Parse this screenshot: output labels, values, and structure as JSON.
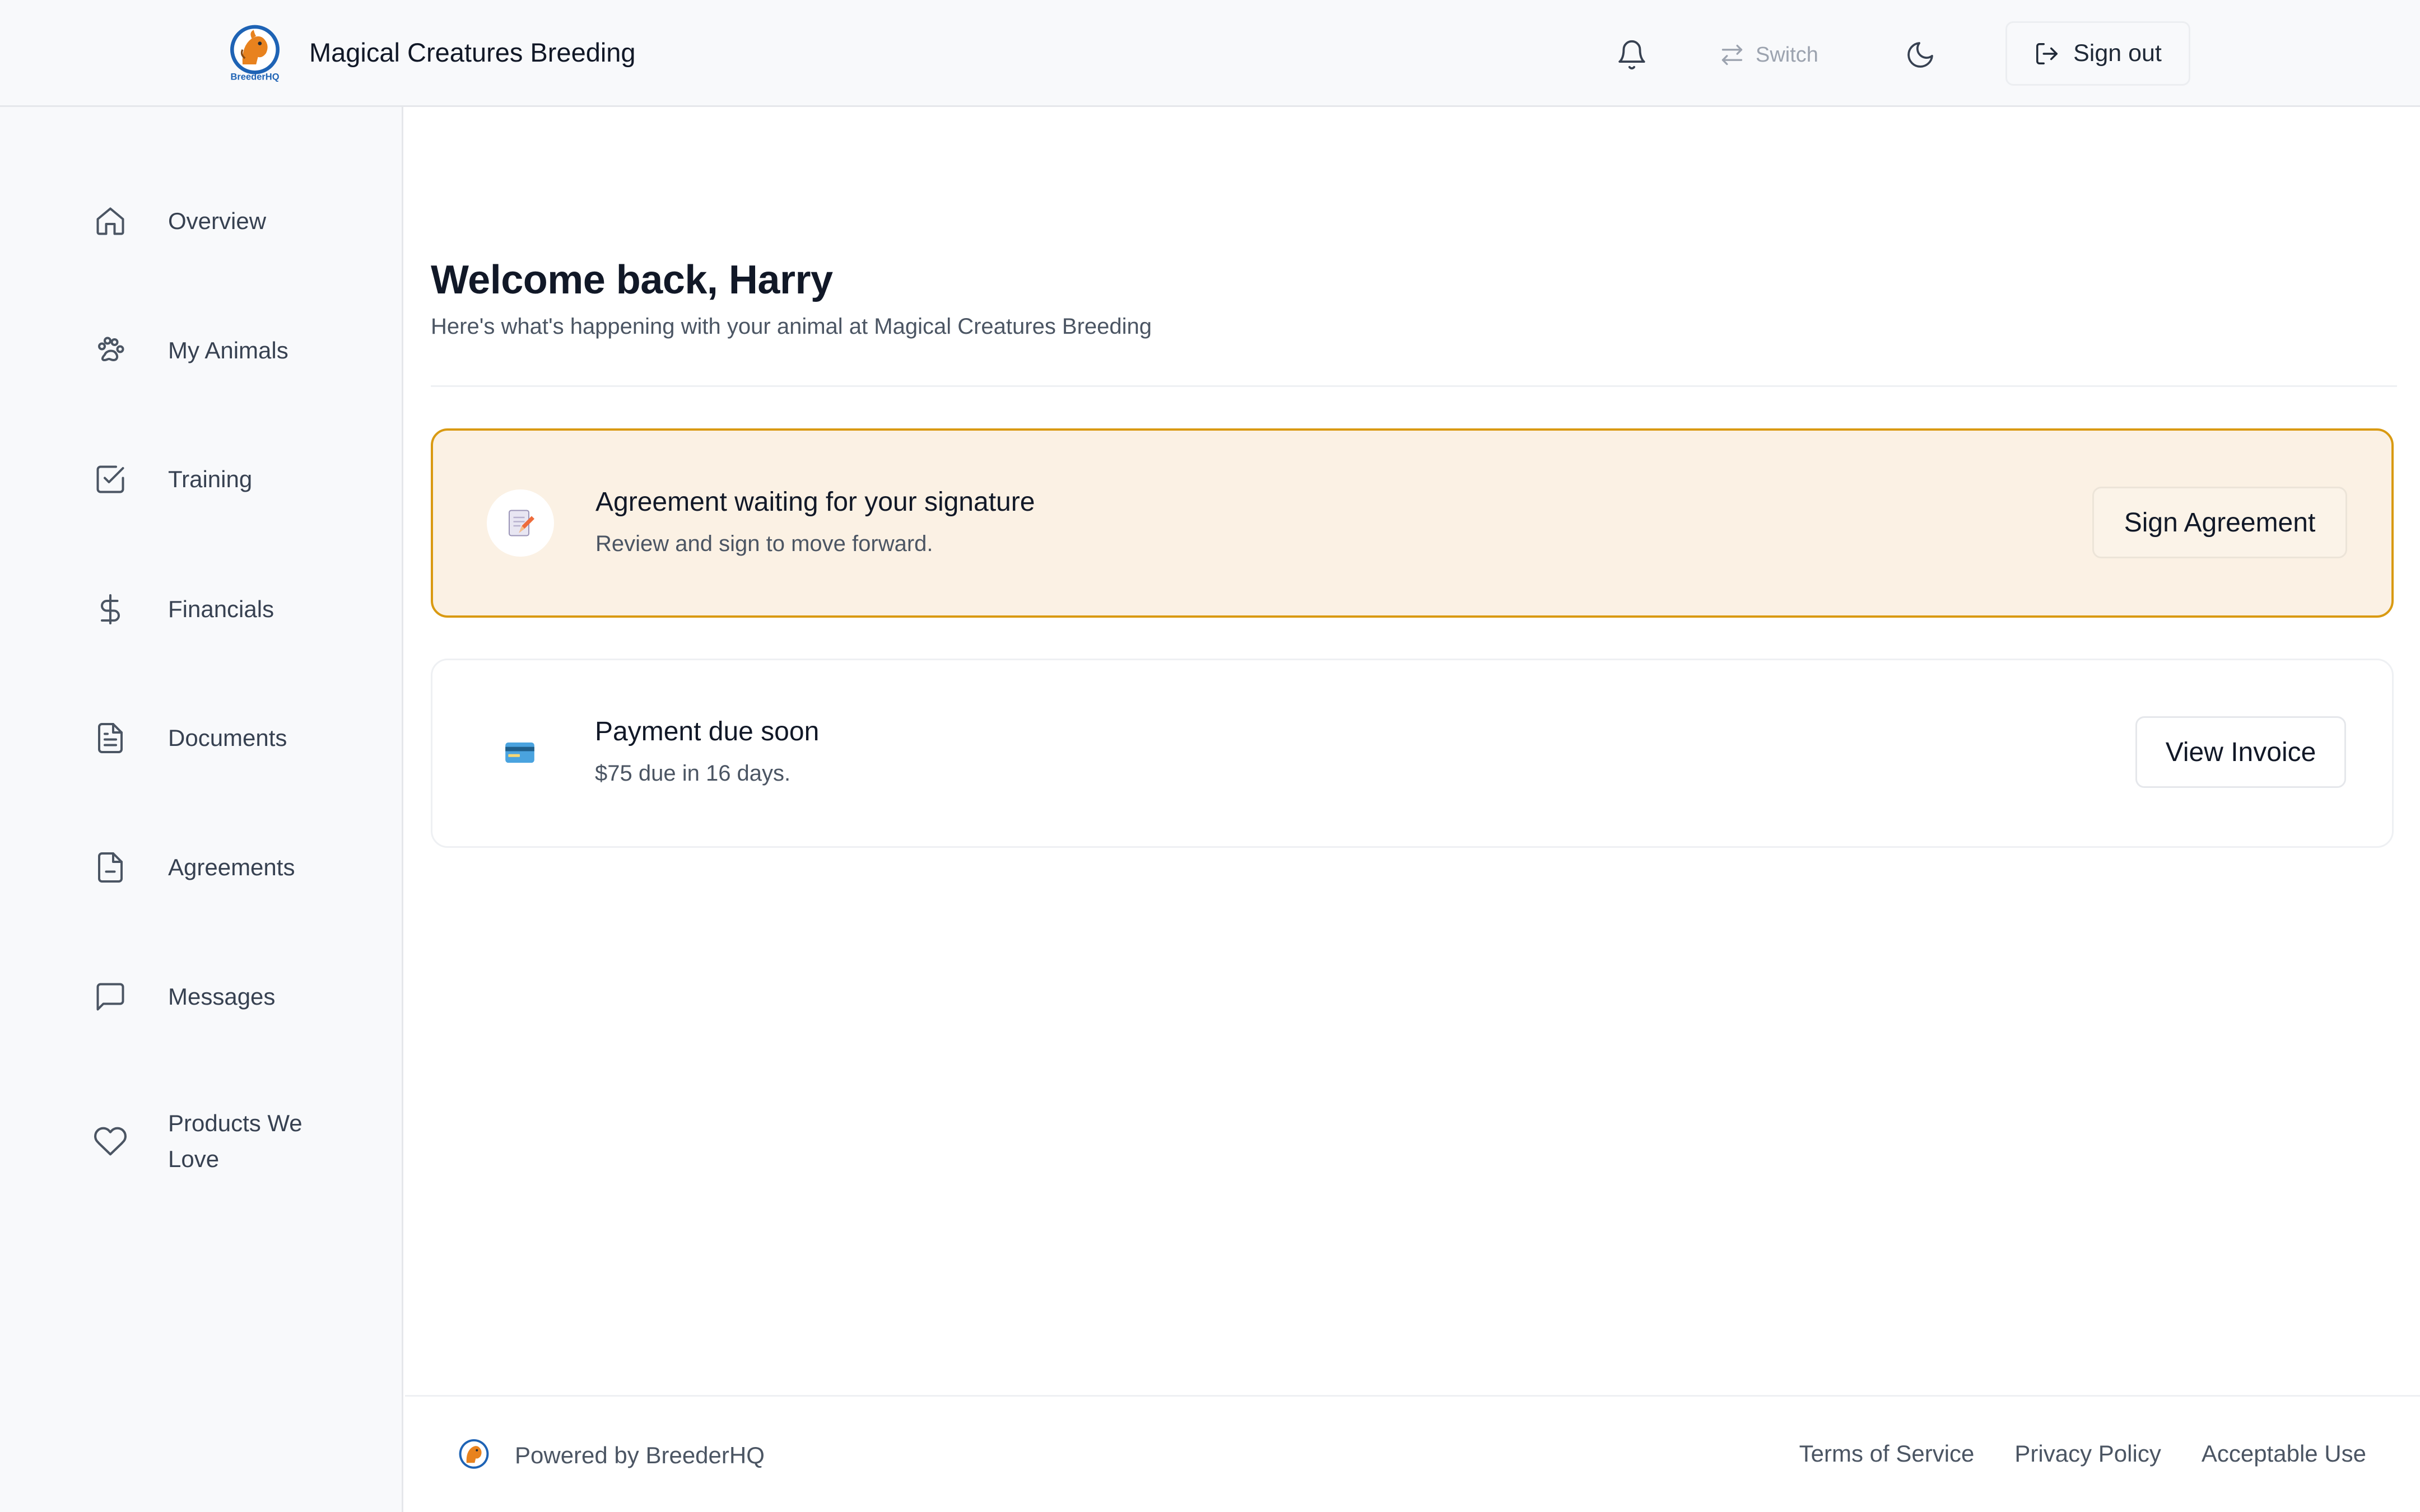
{
  "header": {
    "brand_name": "Magical Creatures Breeding",
    "logo_text": "BreederHQ",
    "switch_label": "Switch",
    "signout_label": "Sign out"
  },
  "sidebar": {
    "items": [
      {
        "label": "Overview",
        "icon": "home-icon"
      },
      {
        "label": "My Animals",
        "icon": "paw-icon"
      },
      {
        "label": "Training",
        "icon": "checkbox-icon"
      },
      {
        "label": "Financials",
        "icon": "dollar-icon"
      },
      {
        "label": "Documents",
        "icon": "document-icon"
      },
      {
        "label": "Agreements",
        "icon": "agreement-file-icon"
      },
      {
        "label": "Messages",
        "icon": "message-icon"
      },
      {
        "label": "Products We Love",
        "icon": "heart-icon"
      }
    ]
  },
  "main": {
    "welcome_title": "Welcome back, Harry",
    "welcome_subtitle": "Here's what's happening with your animal at Magical Creatures Breeding",
    "agreement_card": {
      "title": "Agreement waiting for your signature",
      "description": "Review and sign to move forward.",
      "button_label": "Sign Agreement",
      "icon": "memo-icon"
    },
    "payment_card": {
      "title": "Payment due soon",
      "description": "$75 due in 16 days.",
      "button_label": "View Invoice",
      "icon": "credit-card-icon"
    }
  },
  "footer": {
    "powered_by": "Powered by BreederHQ",
    "links": [
      "Terms of Service",
      "Privacy Policy",
      "Acceptable Use"
    ]
  },
  "colors": {
    "agreement_border": "#d99a12",
    "agreement_bg": "#fbf1e4",
    "sidebar_bg": "#f8f9fb",
    "text_primary": "#111827",
    "text_secondary": "#4b5563"
  }
}
